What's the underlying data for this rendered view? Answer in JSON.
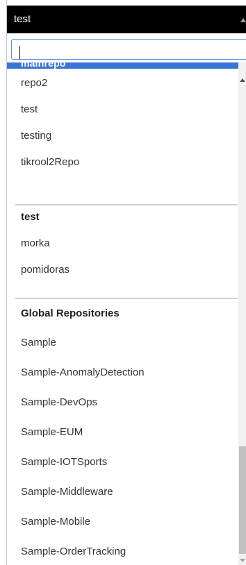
{
  "select": {
    "selected_value": "test"
  },
  "search": {
    "value": "",
    "placeholder": ""
  },
  "highlighted_option": {
    "label": "mainrepo"
  },
  "groups": [
    {
      "label": "",
      "items": [
        "repo2",
        "test",
        "testing",
        "tikrool2Repo"
      ]
    },
    {
      "label": "test",
      "items": [
        "morka",
        "pomidoras"
      ]
    },
    {
      "label": "Global Repositories",
      "items": [
        "Sample",
        "Sample-AnomalyDetection",
        "Sample-DevOps",
        "Sample-EUM",
        "Sample-IOTSports",
        "Sample-Middleware",
        "Sample-Mobile",
        "Sample-OrderTracking"
      ]
    }
  ],
  "colors": {
    "header_bg": "#000000",
    "highlight": "#3875d7",
    "search_border": "#5b8fd6"
  },
  "icons": {
    "select_arrow": "chevron-up-icon",
    "scroll_up": "scroll-up-arrow-icon",
    "scroll_down": "scroll-down-arrow-icon"
  }
}
